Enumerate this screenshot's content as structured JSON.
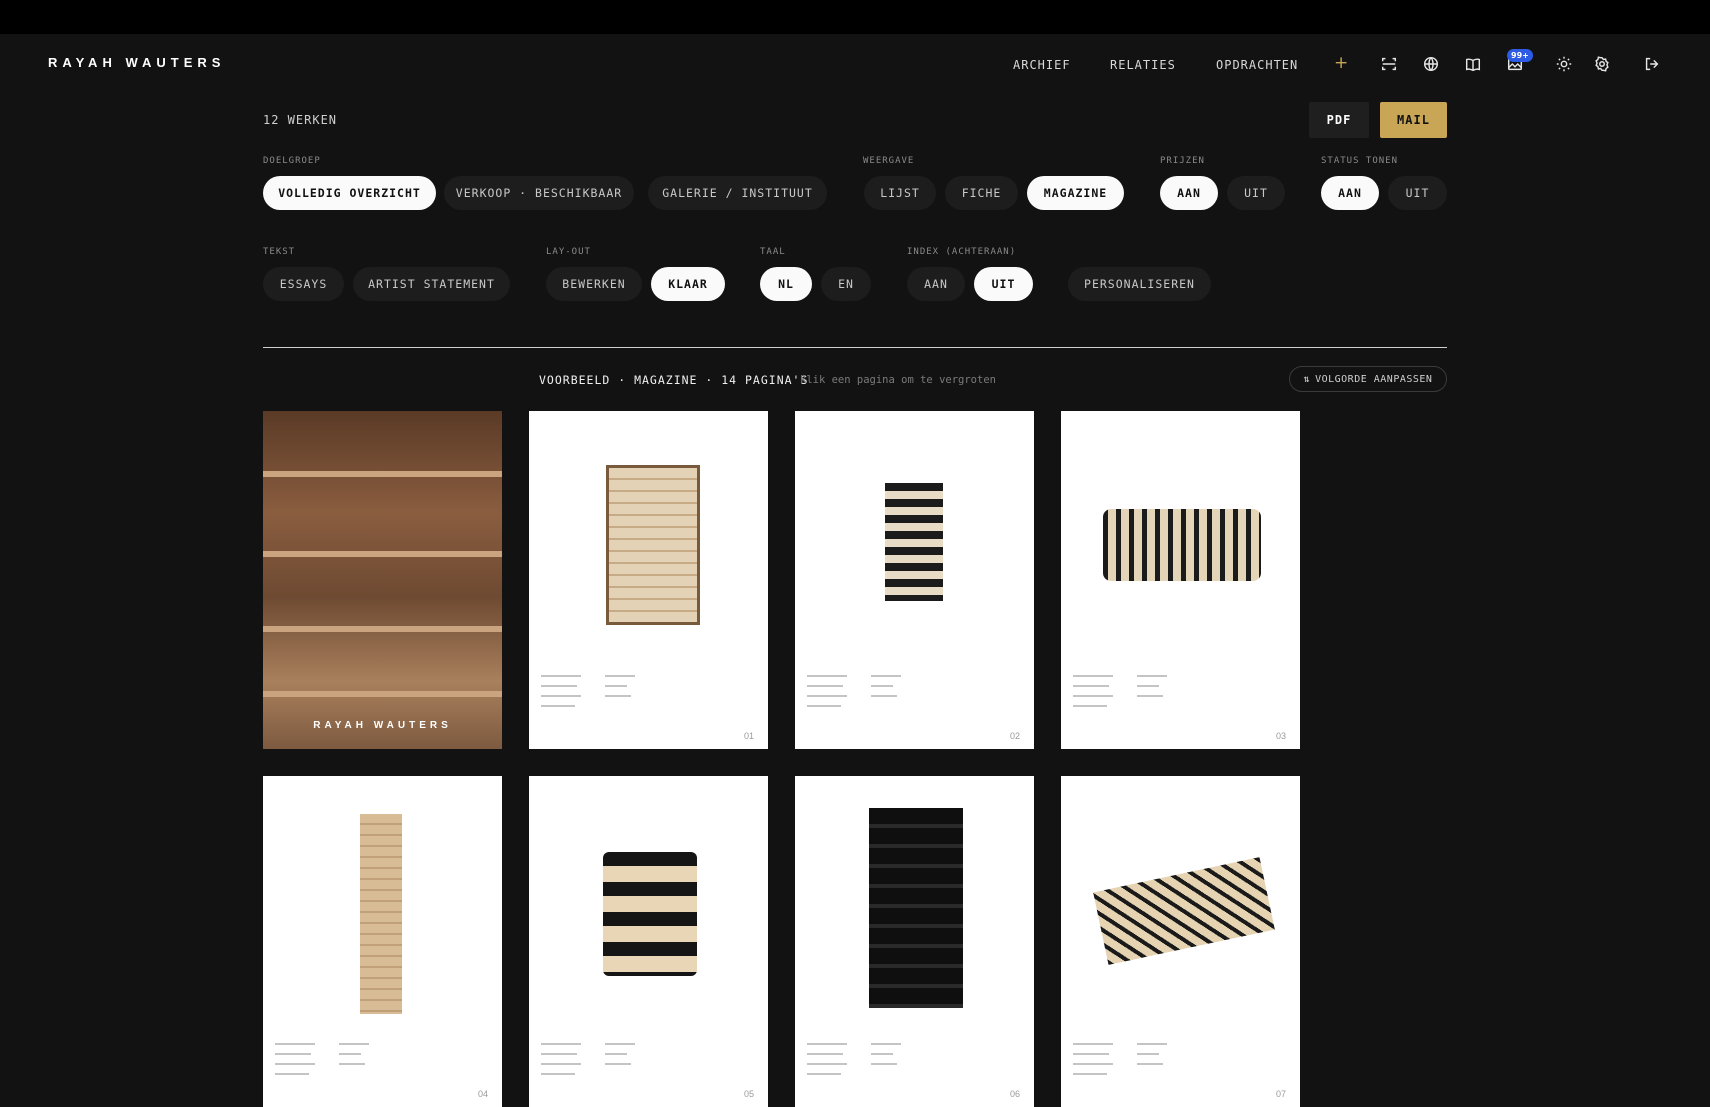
{
  "header": {
    "logo": "RAYAH WAUTERS",
    "nav": [
      "ARCHIEF",
      "RELATIES",
      "OPDRACHTEN"
    ],
    "plus": "+",
    "notifications_badge": "99+",
    "icons": [
      "scan-icon",
      "globe-icon",
      "book-icon",
      "image-icon",
      "sun-icon",
      "gear-icon",
      "logout-icon"
    ]
  },
  "toolbar": {
    "count": "12 WERKEN",
    "pdf": "PDF",
    "mail": "MAIL"
  },
  "filters": {
    "doelgroep": {
      "label": "DOELGROEP",
      "options": [
        "VOLLEDIG OVERZICHT",
        "VERKOOP · BESCHIKBAAR",
        "GALERIE / INSTITUUT"
      ],
      "selected": "VOLLEDIG OVERZICHT"
    },
    "weergave": {
      "label": "WEERGAVE",
      "options": [
        "LIJST",
        "FICHE",
        "MAGAZINE"
      ],
      "selected": "MAGAZINE"
    },
    "prijzen": {
      "label": "PRIJZEN",
      "options": [
        "AAN",
        "UIT"
      ],
      "selected": "AAN"
    },
    "status": {
      "label": "STATUS TONEN",
      "options": [
        "AAN",
        "UIT"
      ],
      "selected": "AAN"
    },
    "tekst": {
      "label": "TEKST",
      "options": [
        "ESSAYS",
        "ARTIST STATEMENT"
      ]
    },
    "layout": {
      "label": "LAY-OUT",
      "options": [
        "BEWERKEN",
        "KLAAR"
      ],
      "selected": "KLAAR"
    },
    "taal": {
      "label": "TAAL",
      "options": [
        "NL",
        "EN"
      ],
      "selected": "NL"
    },
    "index": {
      "label": "INDEX (ACHTERAAN)",
      "options": [
        "AAN",
        "UIT"
      ],
      "selected": "UIT"
    },
    "personaliseren": "PERSONALISEREN"
  },
  "preview": {
    "title": "VOORBEELD · MAGAZINE · 14 PAGINA'S",
    "hint": "klik een pagina om te vergroten",
    "reorder": "VOLGORDE AANPASSEN",
    "reorder_icon": "⇅",
    "cover_name": "RAYAH WAUTERS",
    "page_numbers": [
      "01",
      "02",
      "03",
      "04",
      "05",
      "06",
      "07"
    ]
  },
  "colors": {
    "background": "#121212",
    "accent": "#c9a655",
    "badge": "#2d5be3",
    "active_pill": "#fafafa"
  }
}
